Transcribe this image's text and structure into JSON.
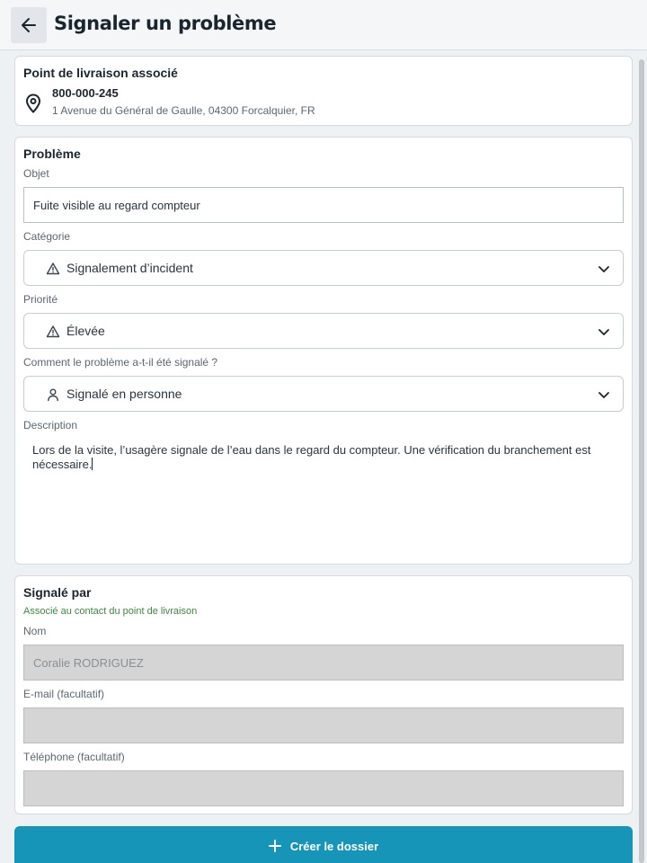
{
  "header": {
    "title": "Signaler un problème"
  },
  "delivery_point": {
    "title": "Point de livraison associé",
    "id": "800-000-245",
    "address": "1 Avenue du Général de Gaulle, 04300 Forcalquier, FR"
  },
  "problem": {
    "title": "Problème",
    "subject_label": "Objet",
    "subject_value": "Fuite visible au regard compteur",
    "category_label": "Catégorie",
    "category_value": "Signalement d’incident",
    "priority_label": "Priorité",
    "priority_value": "Élevée",
    "reported_how_label": "Comment le problème a-t-il été signalé ?",
    "reported_how_value": "Signalé en personne",
    "description_label": "Description",
    "description_value": "Lors de la visite, l’usagère signale de l’eau dans le regard du compteur. Une vérification du branchement est nécessaire."
  },
  "reporter": {
    "title": "Signalé par",
    "associated_note": "Associé au contact du point de livraison",
    "name_label": "Nom",
    "name_value": "Coralie RODRIGUEZ",
    "email_label": "E-mail (facultatif)",
    "email_value": "",
    "phone_label": "Téléphone (facultatif)",
    "phone_value": ""
  },
  "submit": {
    "label": "Créer le dossier"
  },
  "colors": {
    "accent": "#1695b9",
    "note_green": "#3b8a3e"
  }
}
